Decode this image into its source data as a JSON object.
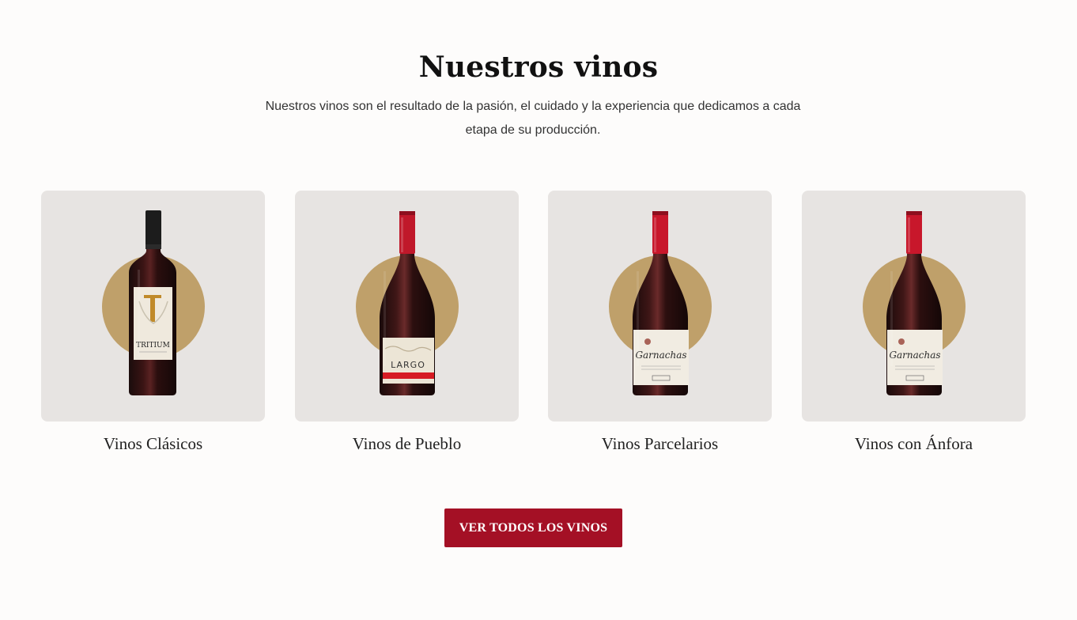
{
  "section": {
    "title": "Nuestros vinos",
    "subtitle": "Nuestros vinos son el resultado de la pasión, el cuidado y la experiencia que dedicamos a cada etapa de su producción."
  },
  "colors": {
    "accent_red": "#a41025",
    "gold_circle": "#bfa06a",
    "card_bg": "#e7e4e2",
    "page_bg": "#fdfcfb"
  },
  "wines": [
    {
      "label": "Vinos Clásicos",
      "bottle_brand": "TRITIUM",
      "bottle_style": "bordeaux-dark-foil"
    },
    {
      "label": "Vinos de Pueblo",
      "bottle_brand": "LARGO",
      "bottle_style": "burgundy-red-capsule"
    },
    {
      "label": "Vinos Parcelarios",
      "bottle_brand": "Garnachas",
      "bottle_style": "burgundy-red-capsule"
    },
    {
      "label": "Vinos con Ánfora",
      "bottle_brand": "Garnachas",
      "bottle_style": "burgundy-red-capsule"
    }
  ],
  "cta": {
    "label": "VER TODOS LOS VINOS"
  }
}
